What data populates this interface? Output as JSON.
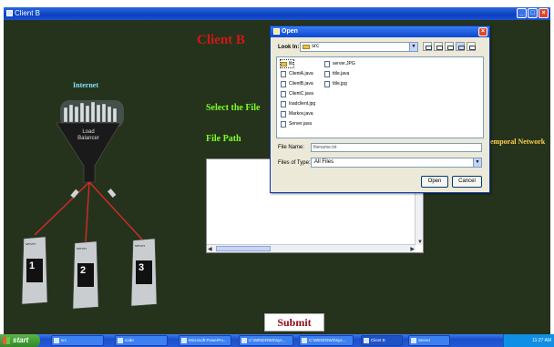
{
  "window": {
    "title": "Client B"
  },
  "main": {
    "heading": "Client B",
    "internet_label": "Internet",
    "load_balancer_label": "Load Balancer",
    "select_label": "Select the File",
    "file_path_label": "File Path",
    "temporal_label": "emporal Network",
    "servers": [
      {
        "tag": "server",
        "number": "1"
      },
      {
        "tag": "server",
        "number": "2"
      },
      {
        "tag": "server",
        "number": "3"
      }
    ],
    "submit_label": "Submit"
  },
  "dialog": {
    "title": "Open",
    "look_in_label": "Look In:",
    "look_in_value": "src",
    "files": [
      {
        "name": "lib",
        "kind": "folder"
      },
      {
        "name": "ClientA.java",
        "kind": "file"
      },
      {
        "name": "ClientB.java",
        "kind": "file"
      },
      {
        "name": "ClientC.java",
        "kind": "file"
      },
      {
        "name": "loadclient.jpg",
        "kind": "file"
      },
      {
        "name": "Markov.java",
        "kind": "file"
      },
      {
        "name": "Server.java",
        "kind": "file"
      },
      {
        "name": "server.JPG",
        "kind": "file"
      },
      {
        "name": "title.java",
        "kind": "file"
      },
      {
        "name": "title.jpg",
        "kind": "file"
      }
    ],
    "file_name_label": "File Name:",
    "file_name_value": "filename.txt",
    "files_of_type_label": "Files of Type:",
    "files_of_type_value": "All Files",
    "open_label": "Open",
    "cancel_label": "Cancel"
  },
  "taskbar": {
    "start_label": "start",
    "items": [
      "src",
      "code",
      "Microsoft PowerPo...",
      "C:\\WINDOWS\\sys...",
      "C:\\WINDOWS\\sys...",
      "Client B",
      "Server"
    ],
    "clock": "11:27 AM"
  }
}
